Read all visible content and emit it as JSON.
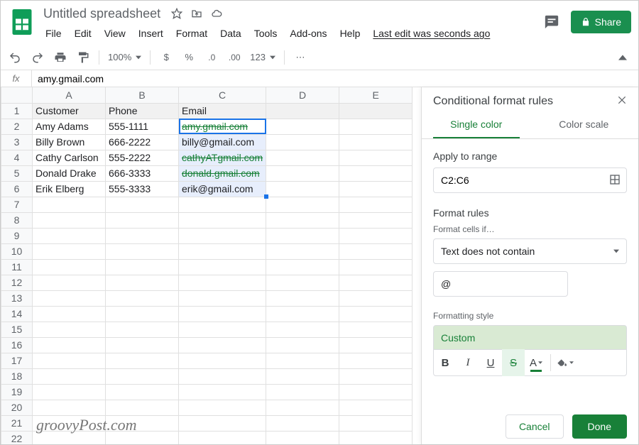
{
  "header": {
    "doc_title": "Untitled spreadsheet",
    "menu": [
      "File",
      "Edit",
      "View",
      "Insert",
      "Format",
      "Data",
      "Tools",
      "Add-ons",
      "Help"
    ],
    "last_edit": "Last edit was seconds ago",
    "share_label": "Share"
  },
  "toolbar": {
    "zoom": "100%",
    "items": [
      "$",
      "%",
      ".0",
      ".00",
      "123"
    ]
  },
  "formula": {
    "fx": "fx",
    "value": "amy.gmail.com"
  },
  "grid": {
    "columns": [
      "A",
      "B",
      "C",
      "D",
      "E"
    ],
    "row_count": 22,
    "headers": {
      "A": "Customer",
      "B": "Phone",
      "C": "Email"
    },
    "rows": [
      {
        "A": "Amy Adams",
        "B": "555-1111",
        "C": "amy.gmail.com",
        "strike": true
      },
      {
        "A": "Billy Brown",
        "B": "666-2222",
        "C": "billy@gmail.com",
        "strike": false
      },
      {
        "A": "Cathy Carlson",
        "B": "555-2222",
        "C": "cathyATgmail.com",
        "strike": true
      },
      {
        "A": "Donald Drake",
        "B": "666-3333",
        "C": "donald.gmail.com",
        "strike": true
      },
      {
        "A": "Erik Elberg",
        "B": "555-3333",
        "C": "erik@gmail.com",
        "strike": false
      }
    ],
    "selection": "C2:C6"
  },
  "sidebar": {
    "title": "Conditional format rules",
    "tabs": {
      "single": "Single color",
      "scale": "Color scale"
    },
    "apply_label": "Apply to range",
    "range": "C2:C6",
    "format_rules_label": "Format rules",
    "format_if_label": "Format cells if…",
    "condition": "Text does not contain",
    "value": "@",
    "style_label": "Formatting style",
    "style_name": "Custom",
    "cancel": "Cancel",
    "done": "Done"
  },
  "watermark": "groovyPost.com"
}
